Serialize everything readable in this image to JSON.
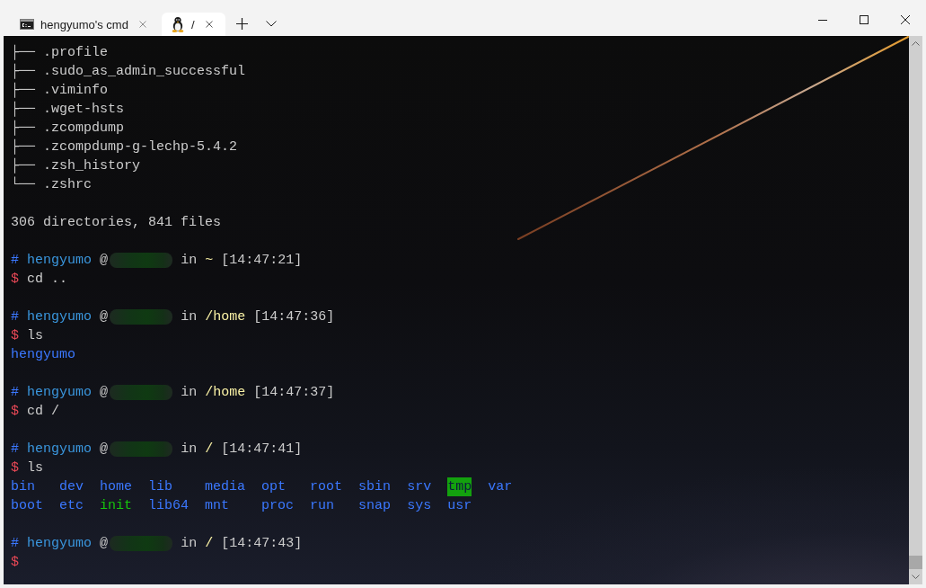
{
  "window": {
    "tabs": [
      {
        "kind": "cmd",
        "title": "hengyumo's cmd",
        "selected": false
      },
      {
        "kind": "linux",
        "title": "/",
        "selected": true
      }
    ]
  },
  "terminal": {
    "lines": [
      {
        "kind": "text",
        "segments": [
          {
            "kind": "plain",
            "text": "├── .profile"
          }
        ]
      },
      {
        "kind": "text",
        "segments": [
          {
            "kind": "plain",
            "text": "├── .sudo_as_admin_successful"
          }
        ]
      },
      {
        "kind": "text",
        "segments": [
          {
            "kind": "plain",
            "text": "├── .viminfo"
          }
        ]
      },
      {
        "kind": "text",
        "segments": [
          {
            "kind": "plain",
            "text": "├── .wget-hsts"
          }
        ]
      },
      {
        "kind": "text",
        "segments": [
          {
            "kind": "plain",
            "text": "├── .zcompdump"
          }
        ]
      },
      {
        "kind": "text",
        "segments": [
          {
            "kind": "plain",
            "text": "├── .zcompdump-g-lechp-5.4.2"
          }
        ]
      },
      {
        "kind": "text",
        "segments": [
          {
            "kind": "plain",
            "text": "├── .zsh_history"
          }
        ]
      },
      {
        "kind": "text",
        "segments": [
          {
            "kind": "plain",
            "text": "└── .zshrc"
          }
        ]
      },
      {
        "kind": "blank"
      },
      {
        "kind": "text",
        "segments": [
          {
            "kind": "plain",
            "text": "306 directories, 841 files"
          }
        ]
      },
      {
        "kind": "blank"
      },
      {
        "kind": "text",
        "segments": [
          {
            "kind": "hash",
            "text": "#"
          },
          {
            "kind": "user",
            "text": "hengyumo"
          },
          {
            "kind": "plain",
            "text": "@"
          },
          {
            "kind": "redacted"
          },
          {
            "kind": "plain",
            "text": "in"
          },
          {
            "kind": "path",
            "text": "~"
          },
          {
            "kind": "plain",
            "text": "[14:47:21]"
          }
        ]
      },
      {
        "kind": "text",
        "segments": [
          {
            "kind": "dollar",
            "text": "$"
          },
          {
            "kind": "command",
            "text": "cd .."
          }
        ]
      },
      {
        "kind": "blank"
      },
      {
        "kind": "text",
        "segments": [
          {
            "kind": "hash",
            "text": "#"
          },
          {
            "kind": "user",
            "text": "hengyumo"
          },
          {
            "kind": "plain",
            "text": "@"
          },
          {
            "kind": "redacted"
          },
          {
            "kind": "plain",
            "text": "in"
          },
          {
            "kind": "path",
            "text": "/home"
          },
          {
            "kind": "plain",
            "text": "[14:47:36]"
          }
        ]
      },
      {
        "kind": "text",
        "segments": [
          {
            "kind": "dollar",
            "text": "$"
          },
          {
            "kind": "command",
            "text": "ls"
          }
        ]
      },
      {
        "kind": "text",
        "segments": [
          {
            "kind": "dir",
            "text": "hengyumo"
          }
        ]
      },
      {
        "kind": "blank"
      },
      {
        "kind": "text",
        "segments": [
          {
            "kind": "hash",
            "text": "#"
          },
          {
            "kind": "user",
            "text": "hengyumo"
          },
          {
            "kind": "plain",
            "text": "@"
          },
          {
            "kind": "redacted"
          },
          {
            "kind": "plain",
            "text": "in"
          },
          {
            "kind": "path",
            "text": "/home"
          },
          {
            "kind": "plain",
            "text": "[14:47:37]"
          }
        ]
      },
      {
        "kind": "text",
        "segments": [
          {
            "kind": "dollar",
            "text": "$"
          },
          {
            "kind": "command",
            "text": "cd /"
          }
        ]
      },
      {
        "kind": "blank"
      },
      {
        "kind": "text",
        "segments": [
          {
            "kind": "hash",
            "text": "#"
          },
          {
            "kind": "user",
            "text": "hengyumo"
          },
          {
            "kind": "plain",
            "text": "@"
          },
          {
            "kind": "redacted"
          },
          {
            "kind": "plain",
            "text": "in"
          },
          {
            "kind": "path",
            "text": "/"
          },
          {
            "kind": "plain",
            "text": "[14:47:41]"
          }
        ]
      },
      {
        "kind": "text",
        "segments": [
          {
            "kind": "dollar",
            "text": "$"
          },
          {
            "kind": "command",
            "text": "ls"
          }
        ]
      },
      {
        "kind": "listing",
        "rows": [
          [
            {
              "kind": "dir",
              "text": "bin"
            },
            {
              "kind": "dir",
              "text": "dev"
            },
            {
              "kind": "dir",
              "text": "home"
            },
            {
              "kind": "dir",
              "text": "lib"
            },
            {
              "kind": "dir",
              "text": "media"
            },
            {
              "kind": "dir",
              "text": "opt"
            },
            {
              "kind": "dir",
              "text": "root"
            },
            {
              "kind": "dir",
              "text": "sbin"
            },
            {
              "kind": "dir",
              "text": "srv"
            },
            {
              "kind": "sticky",
              "text": "tmp"
            },
            {
              "kind": "dir",
              "text": "var"
            }
          ],
          [
            {
              "kind": "dir",
              "text": "boot"
            },
            {
              "kind": "dir",
              "text": "etc"
            },
            {
              "kind": "exec",
              "text": "init"
            },
            {
              "kind": "dir",
              "text": "lib64"
            },
            {
              "kind": "dir",
              "text": "mnt"
            },
            {
              "kind": "dir",
              "text": "proc"
            },
            {
              "kind": "dir",
              "text": "run"
            },
            {
              "kind": "dir",
              "text": "snap"
            },
            {
              "kind": "dir",
              "text": "sys"
            },
            {
              "kind": "dir",
              "text": "usr"
            }
          ]
        ]
      },
      {
        "kind": "blank"
      },
      {
        "kind": "text",
        "segments": [
          {
            "kind": "hash",
            "text": "#"
          },
          {
            "kind": "user",
            "text": "hengyumo"
          },
          {
            "kind": "plain",
            "text": "@"
          },
          {
            "kind": "redacted"
          },
          {
            "kind": "plain",
            "text": "in"
          },
          {
            "kind": "path",
            "text": "/"
          },
          {
            "kind": "plain",
            "text": "[14:47:43]"
          }
        ]
      },
      {
        "kind": "text",
        "segments": [
          {
            "kind": "dollar",
            "text": "$"
          }
        ]
      }
    ]
  }
}
